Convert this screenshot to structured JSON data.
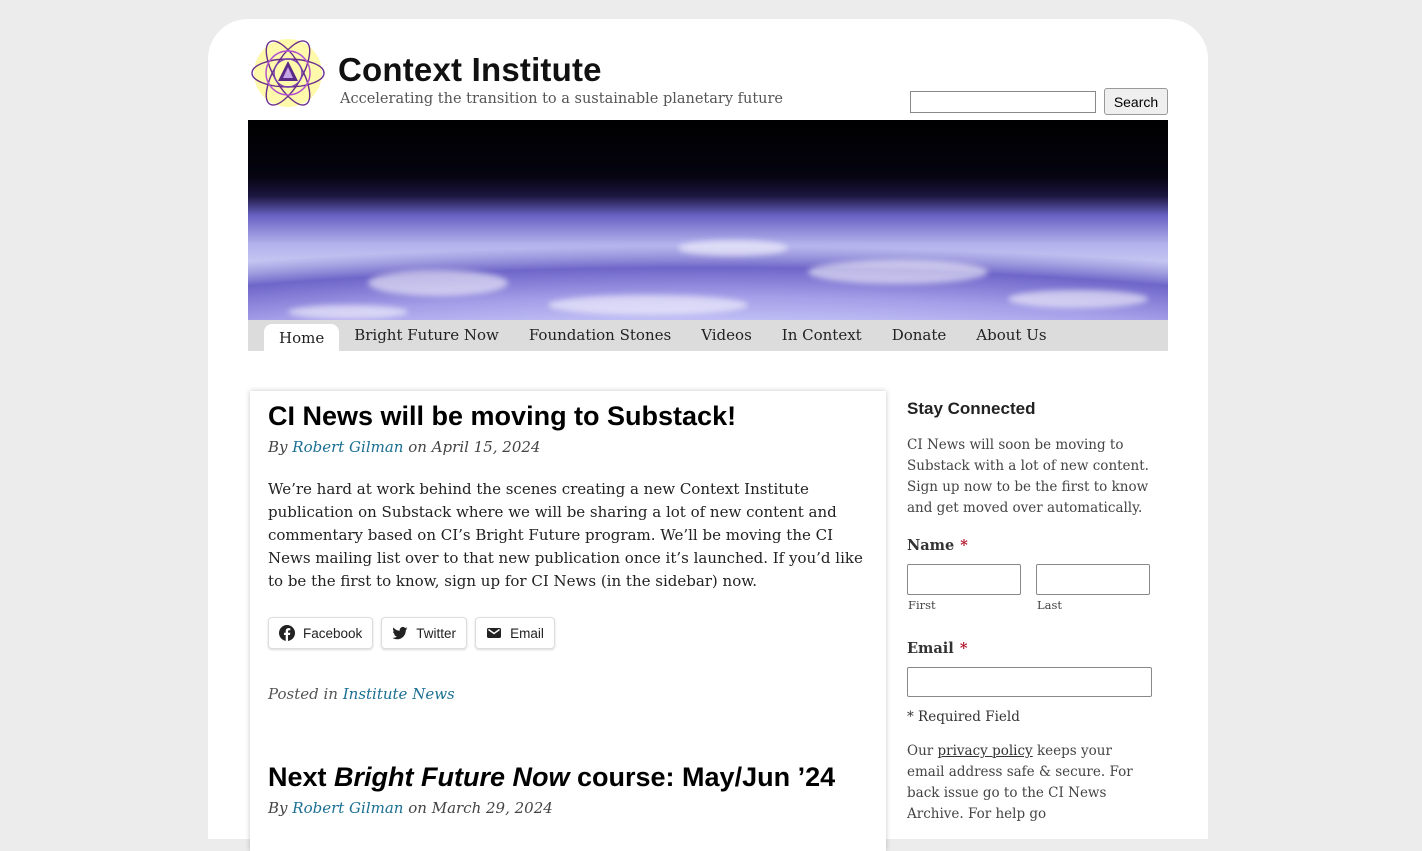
{
  "header": {
    "site_title": "Context Institute",
    "tagline": "Accelerating the transition to a sustainable planetary future",
    "search_button": "Search",
    "search_value": ""
  },
  "nav": {
    "items": [
      {
        "label": "Home"
      },
      {
        "label": "Bright Future Now"
      },
      {
        "label": "Foundation Stones"
      },
      {
        "label": "Videos"
      },
      {
        "label": "In Context"
      },
      {
        "label": "Donate"
      },
      {
        "label": "About Us"
      }
    ]
  },
  "posts": [
    {
      "title": "CI News will be moving to Substack!",
      "by": "By",
      "author": "Robert Gilman",
      "date": "on April 15, 2024",
      "body": "We’re hard at work behind the scenes creating a new Context Institute publication on Substack where we will be sharing a lot of new content and commentary based on CI’s Bright Future program. We’ll be moving the CI News mailing list over to that new publication once it’s launched. If you’d like to be the first to know, sign up for CI News (in the sidebar) now.",
      "share": {
        "facebook": "Facebook",
        "twitter": "Twitter",
        "email": "Email"
      },
      "posted_in": "Posted in",
      "category": "Institute News"
    },
    {
      "title_prefix": "Next ",
      "title_em": "Bright Future Now",
      "title_suffix": " course: May/Jun ’24",
      "by": "By",
      "author": "Robert Gilman",
      "date": "on March 29, 2024"
    }
  ],
  "sidebar": {
    "title": "Stay Connected",
    "intro": "CI News will soon be moving to Substack with a lot of new content. Sign up now to be the first to know and get moved over automatically.",
    "name_label": "Name",
    "required_mark": "*",
    "first_sub": "First",
    "last_sub": "Last",
    "email_label": "Email",
    "required_note": "* Required Field",
    "privacy_pre": "Our ",
    "privacy_link": "privacy policy",
    "privacy_post": " keeps your email address safe & secure. For back issue go to the CI News Archive. For help go"
  }
}
